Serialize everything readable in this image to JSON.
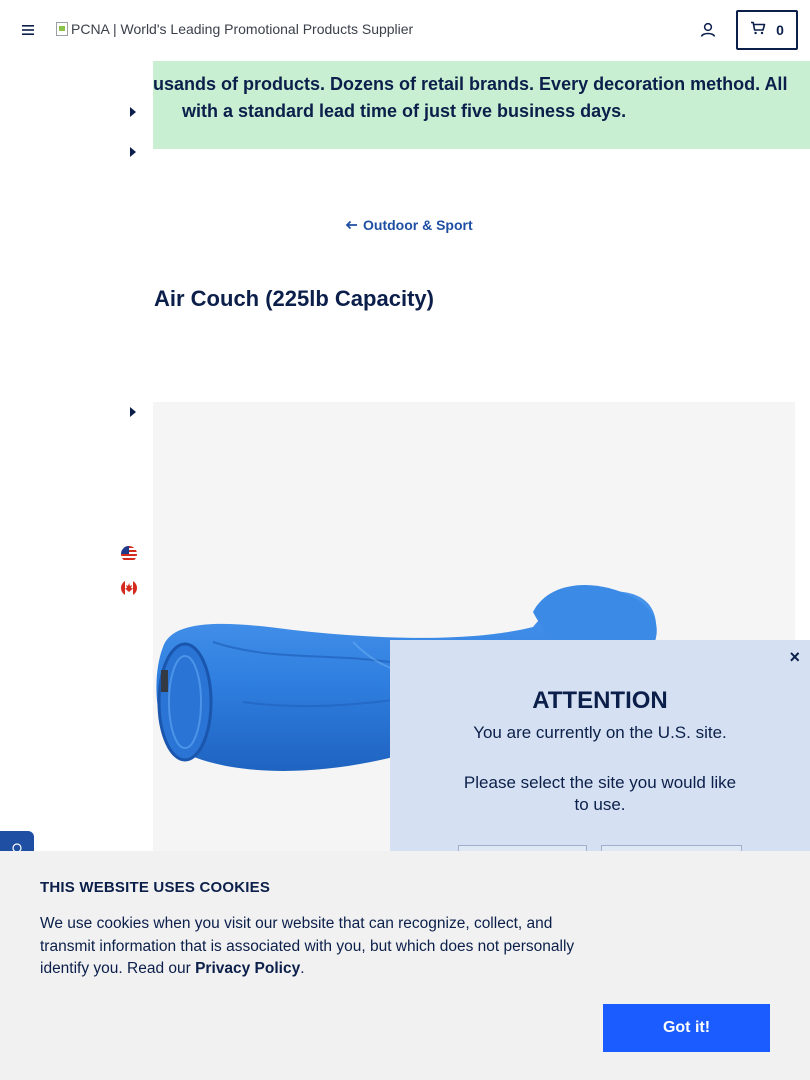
{
  "header": {
    "logo_alt": "PCNA | World's Leading Promotional Products Supplier",
    "cart_count": "0",
    "icons": {
      "menu": "hamburger-menu-icon",
      "account": "user-icon",
      "cart": "cart-icon"
    }
  },
  "promo": {
    "line1": "usands of products. Dozens of retail brands. Every decoration method. All",
    "line2": "with a standard lead time of just five business days."
  },
  "breadcrumb": {
    "label": "Outdoor & Sport",
    "icon": "arrow-left-icon"
  },
  "product": {
    "title": "Air Couch (225lb Capacity)",
    "image_color": "#2f7fe0"
  },
  "site_selector": {
    "title": "ATTENTION",
    "message": "You are currently on the U.S. site.",
    "prompt": "Please select the site you would like to use.",
    "close_label": "×",
    "flags": [
      "us-flag-icon",
      "canada-flag-icon"
    ]
  },
  "cookie_banner": {
    "title": "THIS WEBSITE USES COOKIES",
    "text_before": "We use cookies when you visit our website that can recognize, collect, and transmit information that is associated with you, but which does not personally identify you. Read our ",
    "link_label": "Privacy Policy",
    "text_after": ".",
    "accept_label": "Got it!",
    "accent": "#1a5cff"
  },
  "colors": {
    "navy": "#0b1f4a",
    "promo_bg": "#c9efd3",
    "link_blue": "#1e4fa3",
    "modal_bg": "#d5e1f2"
  }
}
